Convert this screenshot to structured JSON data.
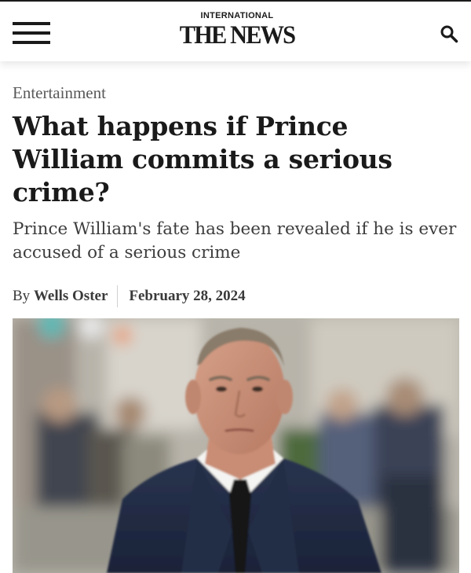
{
  "header": {
    "logo_top": "INTERNATIONAL",
    "logo_main": "THE NEWS",
    "menu_icon": "hamburger-menu-icon",
    "search_icon": "search-icon"
  },
  "article": {
    "category": "Entertainment",
    "headline": "What happens if Prince William commits a serious crime?",
    "subheadline": "Prince William's fate has been revealed if he is ever accused of a serious crime",
    "byline": {
      "prefix": "By",
      "author": "Wells Oster",
      "date": "February 28, 2024"
    }
  },
  "colors": {
    "text_dark": "#1a1a1a",
    "category_gray": "#595959",
    "subhead_gray": "#3d3d3d"
  }
}
